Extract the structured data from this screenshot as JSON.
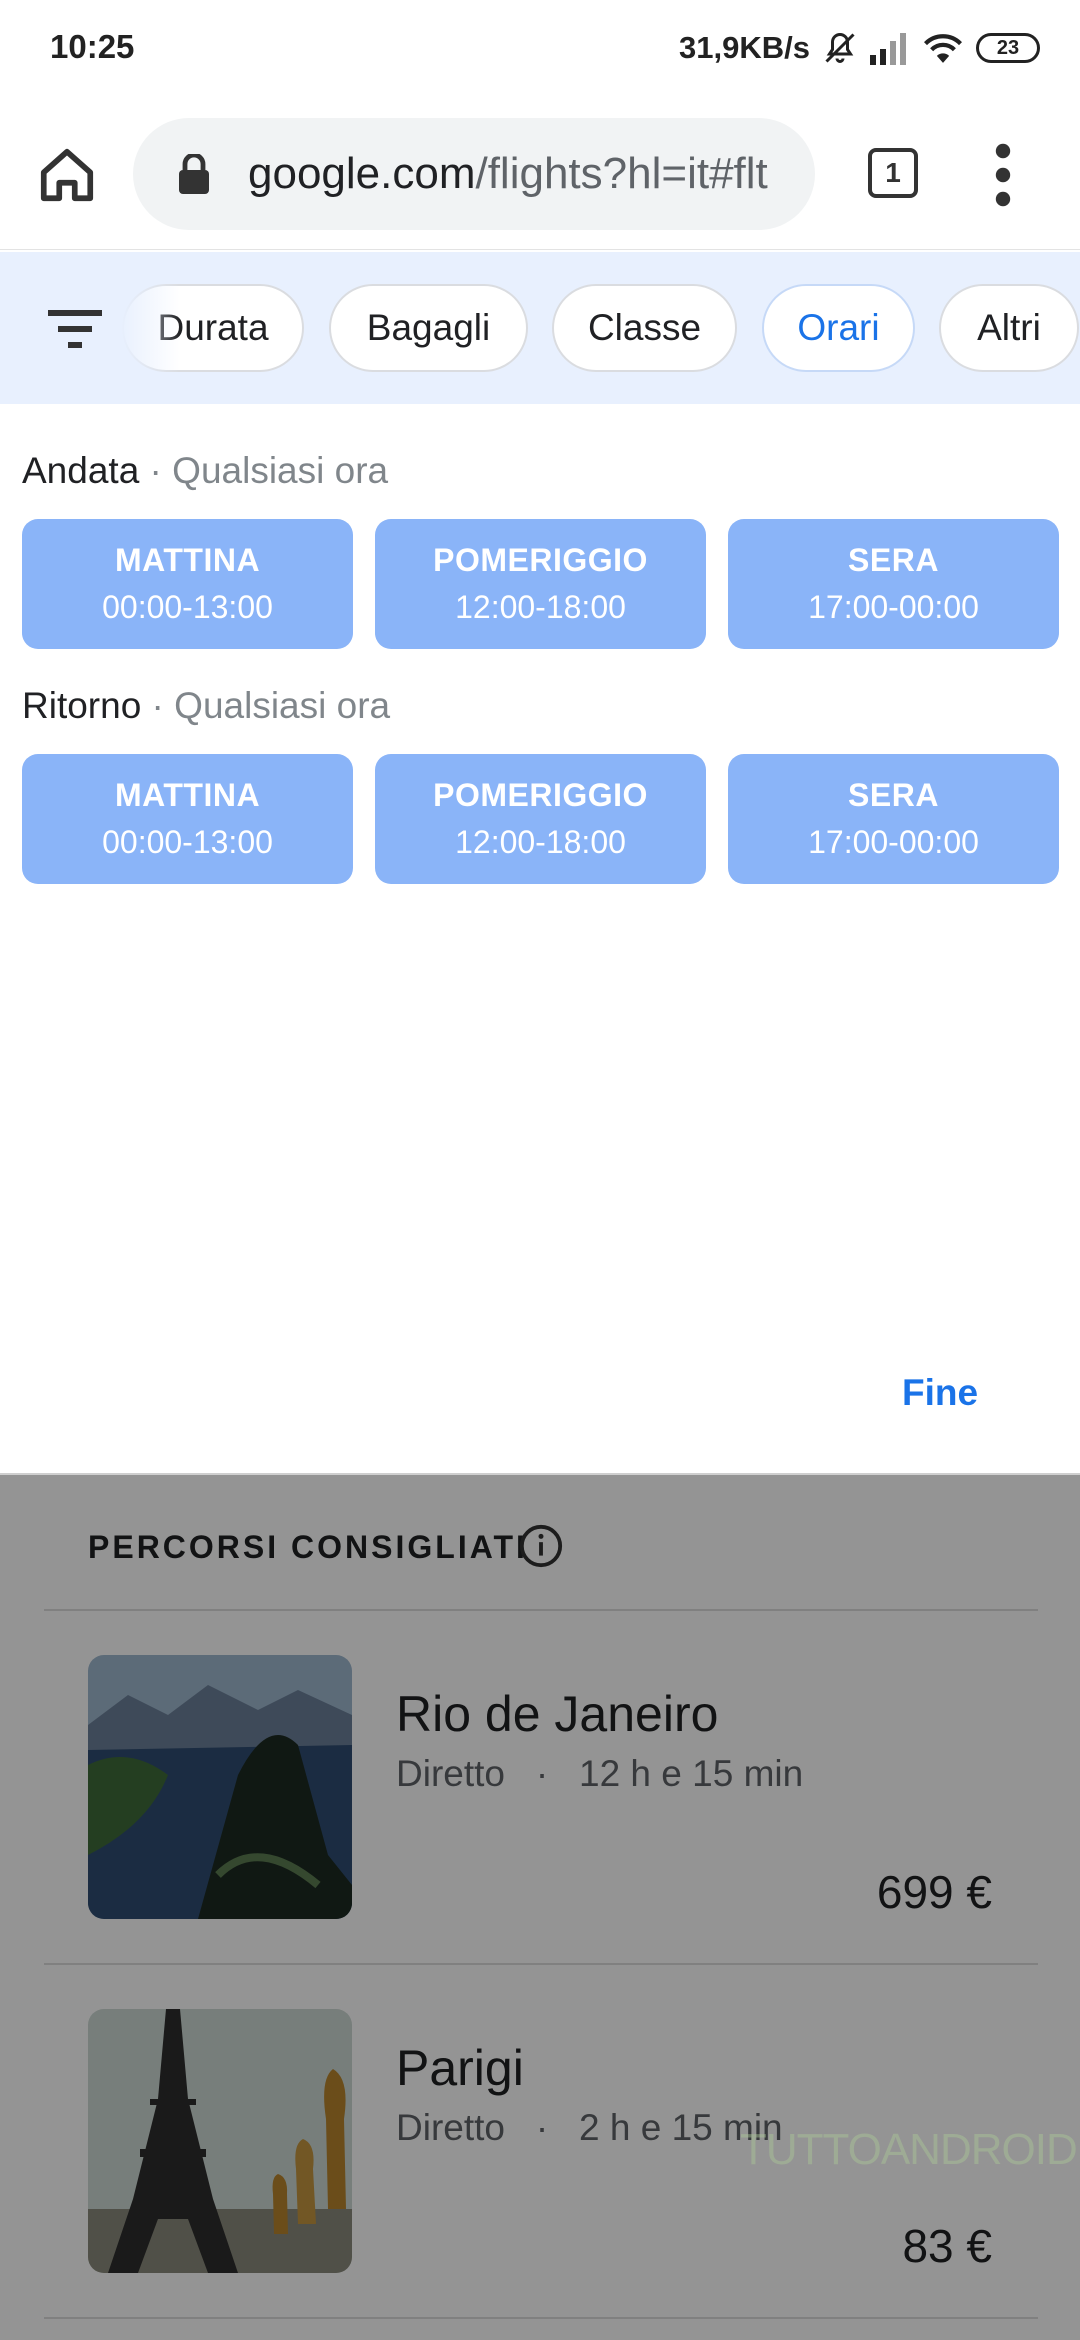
{
  "status_bar": {
    "time": "10:25",
    "network_speed": "31,9KB/s",
    "battery": "23",
    "icons": [
      "mute-bell-icon",
      "signal-icon",
      "wifi-icon",
      "battery-icon"
    ]
  },
  "browser": {
    "url_domain": "google.com",
    "url_path": "/flights?hl=it#flt",
    "tab_count": "1",
    "icons": [
      "home-icon",
      "lock-icon",
      "overflow-menu-icon"
    ]
  },
  "filters": {
    "chips": [
      {
        "label": "Durata",
        "active": false
      },
      {
        "label": "Bagagli",
        "active": false
      },
      {
        "label": "Classe",
        "active": false
      },
      {
        "label": "Orari",
        "active": true
      },
      {
        "label": "Altri",
        "active": false
      }
    ],
    "accent_color": "#1a73e8"
  },
  "times": {
    "outbound": {
      "label": "Andata",
      "separator": " · ",
      "value": "Qualsiasi ora",
      "options": [
        {
          "name": "MATTINA",
          "range": "00:00-13:00"
        },
        {
          "name": "POMERIGGIO",
          "range": "12:00-18:00"
        },
        {
          "name": "SERA",
          "range": "17:00-00:00"
        }
      ]
    },
    "return": {
      "label": "Ritorno",
      "separator": " · ",
      "value": "Qualsiasi ora",
      "options": [
        {
          "name": "MATTINA",
          "range": "00:00-13:00"
        },
        {
          "name": "POMERIGGIO",
          "range": "12:00-18:00"
        },
        {
          "name": "SERA",
          "range": "17:00-00:00"
        }
      ]
    },
    "done_label": "Fine",
    "button_color": "#8ab4f8"
  },
  "results": {
    "header": "PERCORSI CONSIGLIATI",
    "items": [
      {
        "destination": "Rio de Janeiro",
        "stops": "Diretto",
        "sep": "·",
        "duration": "12 h e 15 min",
        "price": "699 €"
      },
      {
        "destination": "Parigi",
        "stops": "Diretto",
        "sep": "·",
        "duration": "2 h e 15 min",
        "price": "83 €"
      }
    ],
    "watermark": "TUTTOANDROID"
  }
}
